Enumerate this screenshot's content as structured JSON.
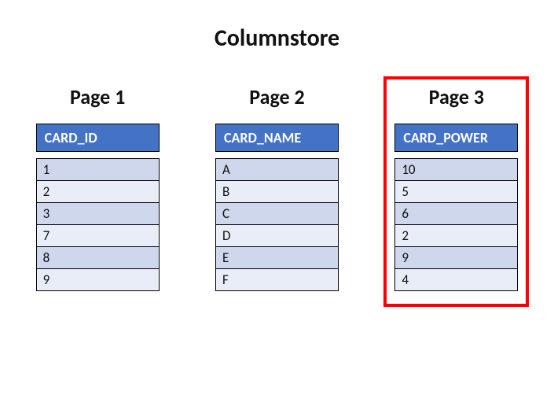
{
  "title": "Columnstore",
  "pages": [
    {
      "label": "Page 1",
      "header": "CARD_ID",
      "highlight": false,
      "rows": [
        "1",
        "2",
        "3",
        "7",
        "8",
        "9"
      ]
    },
    {
      "label": "Page 2",
      "header": "CARD_NAME",
      "highlight": false,
      "rows": [
        "A",
        "B",
        "C",
        "D",
        "E",
        "F"
      ]
    },
    {
      "label": "Page 3",
      "header": "CARD_POWER",
      "highlight": true,
      "rows": [
        "10",
        "5",
        "6",
        "2",
        "9",
        "4"
      ]
    }
  ]
}
